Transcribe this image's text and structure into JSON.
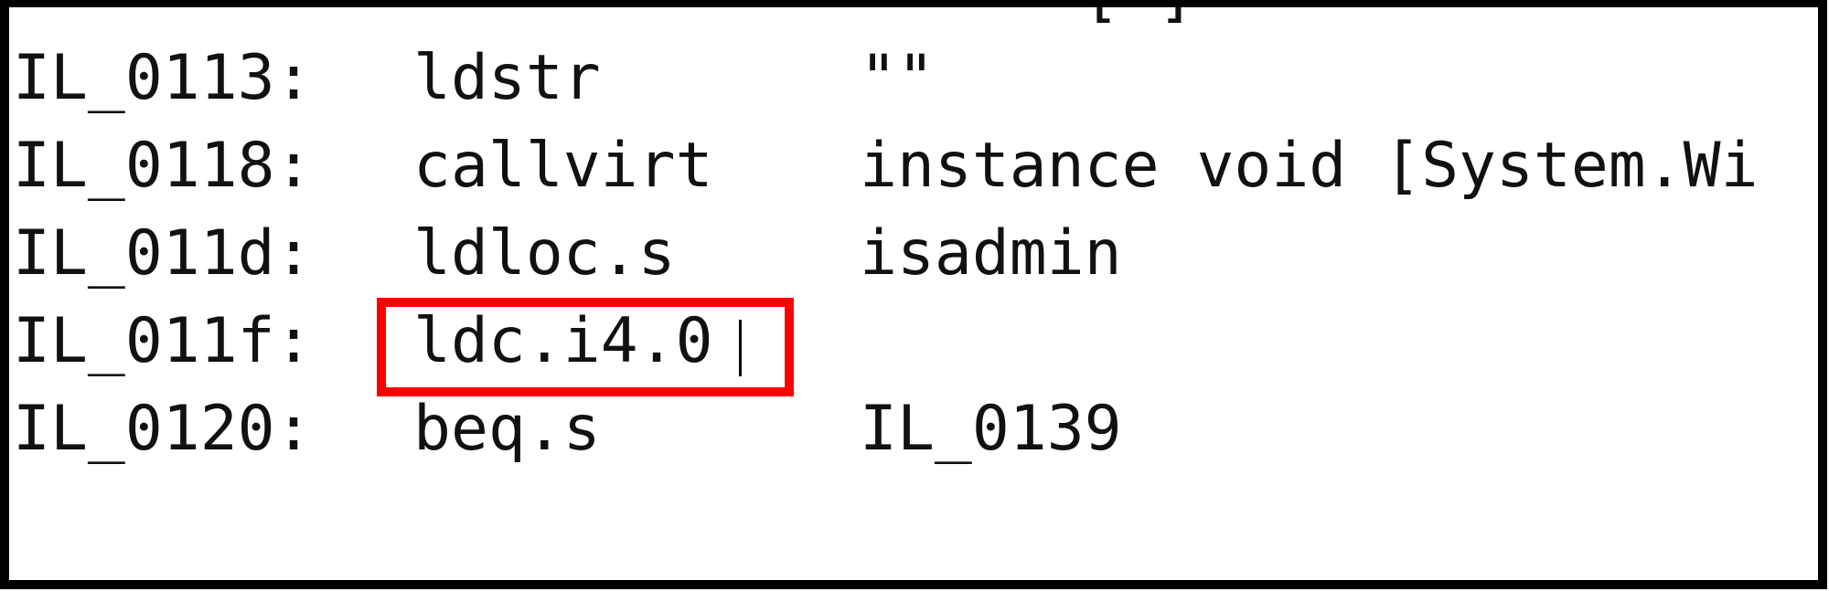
{
  "editor": {
    "accent_highlight": "#ff0000",
    "top_partial_line": "[ ]",
    "lines": [
      {
        "label": "IL_0113:",
        "opcode": "ldstr",
        "operand": "\"\""
      },
      {
        "label": "IL_0118:",
        "opcode": "callvirt",
        "operand": "instance void [System.Wi"
      },
      {
        "label": "IL_011d:",
        "opcode": "ldloc.s",
        "operand": "isadmin"
      },
      {
        "label": "IL_011f:",
        "opcode": "ldc.i4.0",
        "operand": ""
      },
      {
        "label": "IL_0120:",
        "opcode": "beq.s",
        "operand": "IL_0139"
      }
    ]
  }
}
